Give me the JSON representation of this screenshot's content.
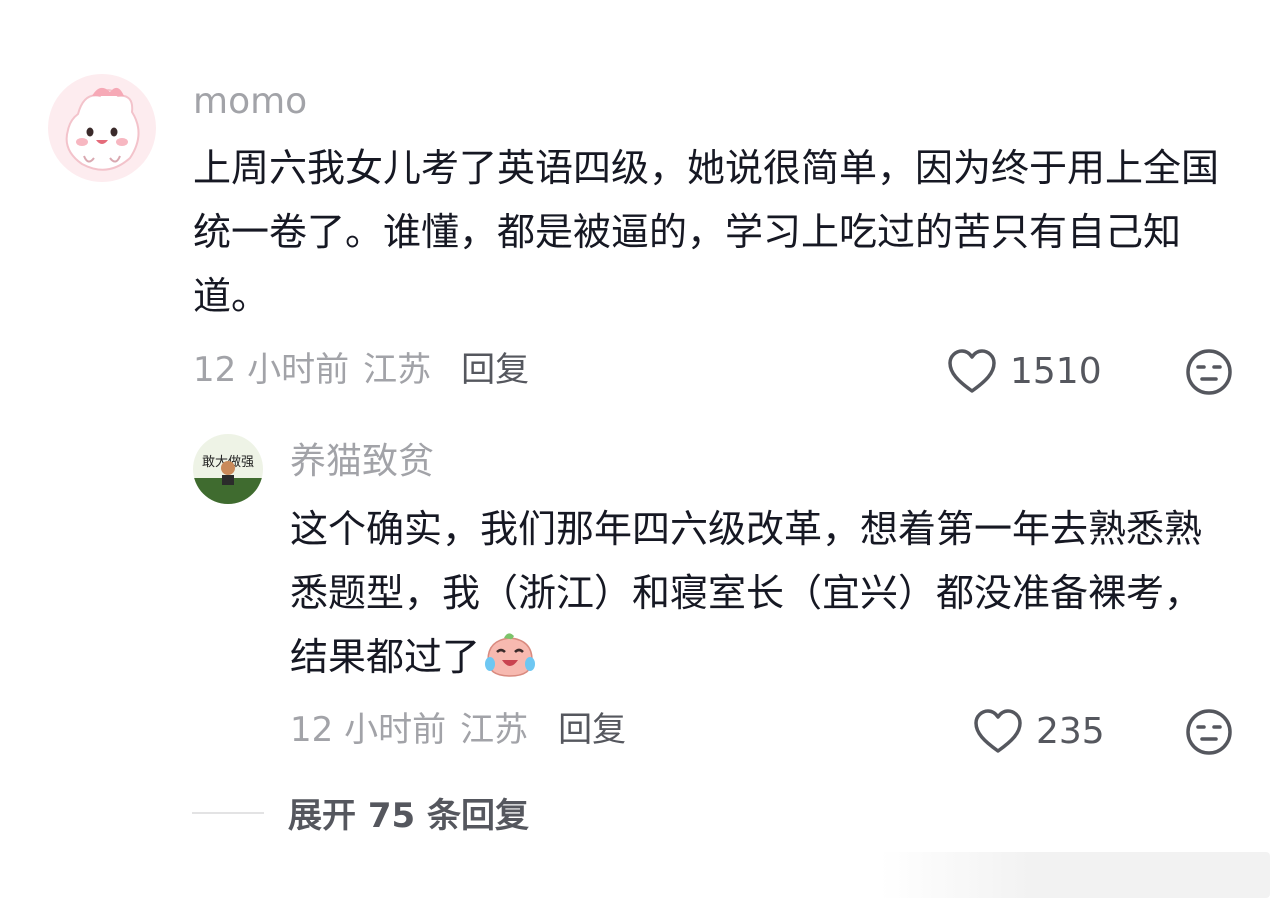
{
  "top_comment": {
    "username": "momo",
    "text": "上周六我女儿考了英语四级，她说很简单，因为终于用上全国统一卷了。谁懂，都是被逼的，学习上吃过的苦只有自己知道。",
    "time": "12 小时前",
    "location": "江苏",
    "reply_label": "回复",
    "likes": "1510",
    "avatar_icon": "pink-cartoon-avatar",
    "dislike_icon": "meh-face-icon"
  },
  "reply": {
    "username": "养猫致贫",
    "text": "这个确实，我们那年四六级改革，想着第一年去熟悉熟悉题型，我（浙江）和寝室长（宜兴）都没准备裸考，结果都过了",
    "emoji": "laugh-cry-emoji",
    "avatar_text": "敢大做强",
    "time": "12 小时前",
    "location": "江苏",
    "reply_label": "回复",
    "likes": "235",
    "dislike_icon": "meh-face-icon"
  },
  "expand_replies": {
    "label": "展开 75 条回复"
  },
  "colors": {
    "primary_text": "#161823",
    "secondary_text": "#a2a3a8",
    "action_text": "#55575e",
    "divider": "#e3e3e4"
  }
}
